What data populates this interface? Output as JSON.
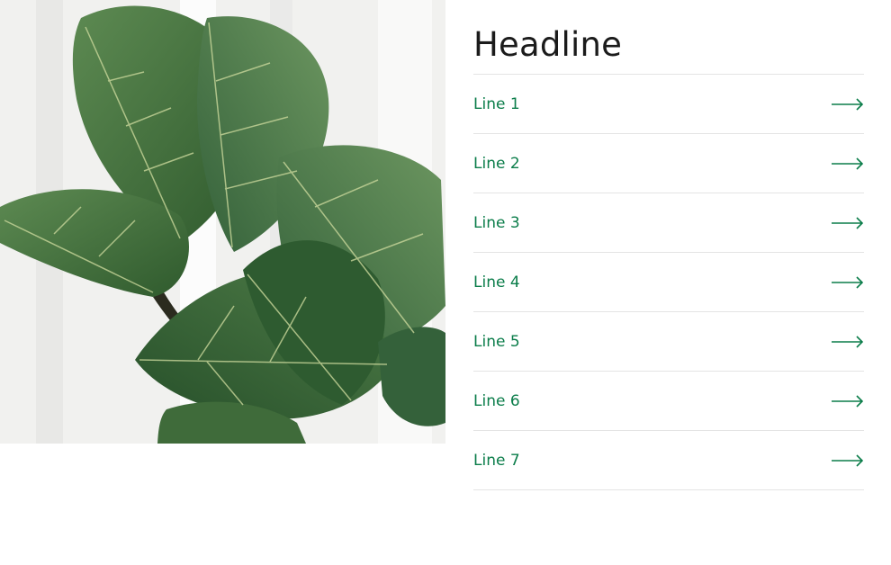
{
  "headline": "Headline",
  "items": [
    {
      "label": "Line 1",
      "icon": "arrow-right-icon"
    },
    {
      "label": "Line 2",
      "icon": "arrow-right-icon"
    },
    {
      "label": "Line 3",
      "icon": "arrow-right-icon"
    },
    {
      "label": "Line 4",
      "icon": "arrow-right-icon"
    },
    {
      "label": "Line 5",
      "icon": "arrow-right-icon"
    },
    {
      "label": "Line 6",
      "icon": "arrow-right-icon"
    },
    {
      "label": "Line 7",
      "icon": "arrow-right-icon"
    }
  ],
  "colors": {
    "accent": "#0b7d4a",
    "headline": "#1b1b1b",
    "divider": "#e4e4e4",
    "leaf": "#3f6b3a"
  },
  "photo": {
    "subject": "fiddle-leaf-fig-plant-photo"
  }
}
